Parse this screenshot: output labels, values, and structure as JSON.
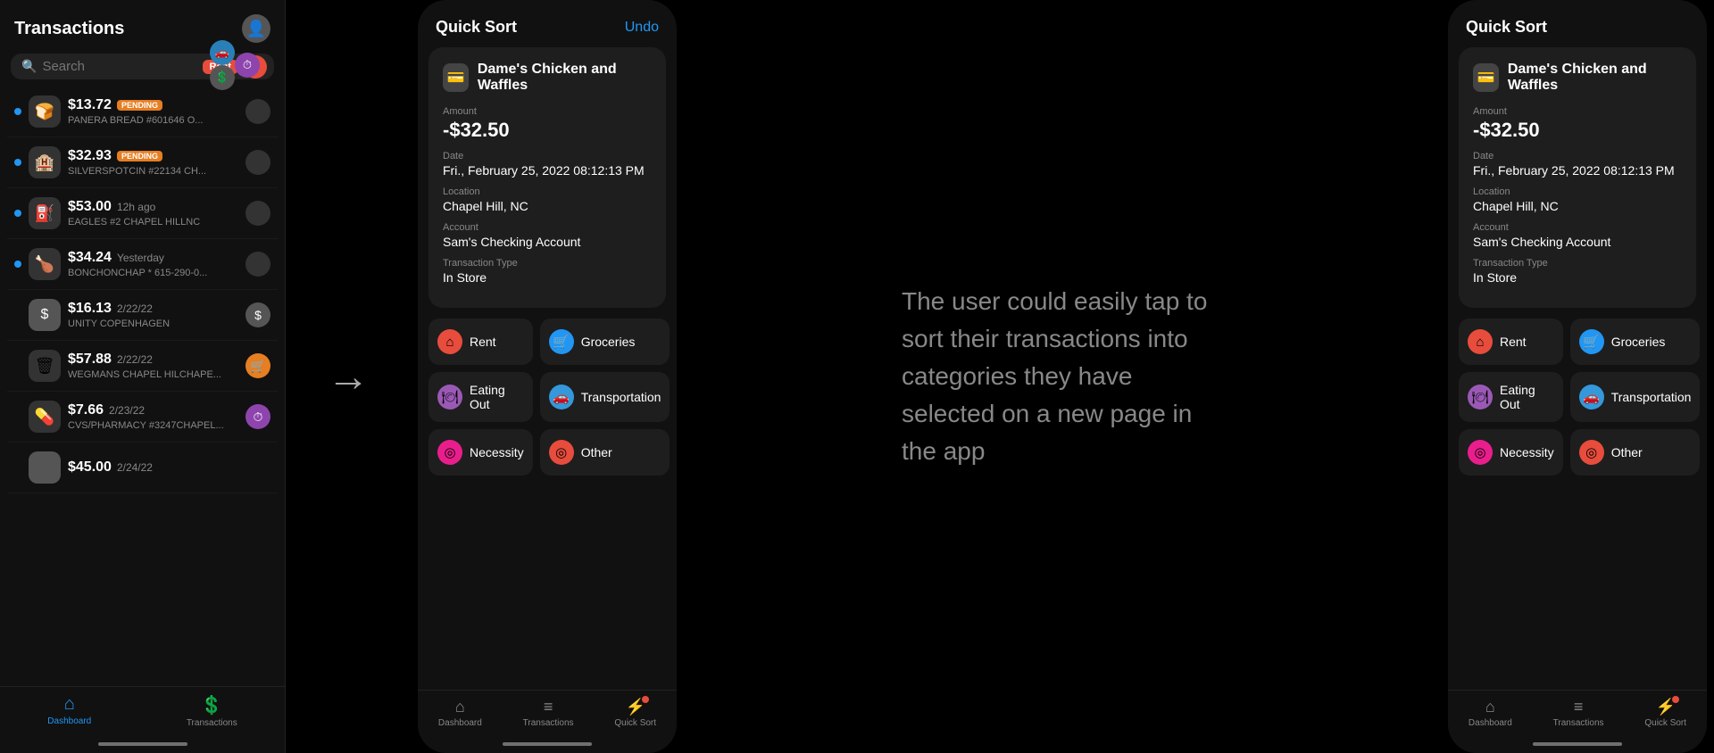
{
  "panel1": {
    "title": "Transactions",
    "search_placeholder": "Search",
    "rent_badge": "Rent",
    "transactions": [
      {
        "amount": "$13.72",
        "status": "PENDING",
        "name": "PANERA BREAD #601646 O...",
        "time": "",
        "icon": "🍞",
        "dot": true,
        "circle": "empty"
      },
      {
        "amount": "$32.93",
        "status": "PENDING",
        "name": "SILVERSPOTCIN #22134 CH...",
        "time": "",
        "icon": "🏨",
        "dot": true,
        "circle": "empty"
      },
      {
        "amount": "$53.00",
        "status": "",
        "time": "12h ago",
        "name": "EAGLES #2 CHAPEL HILLNC",
        "icon": "⛽",
        "dot": true,
        "circle": "empty"
      },
      {
        "amount": "$34.24",
        "status": "",
        "time": "Yesterday",
        "name": "BONCHONCHAP * 615-290-0...",
        "icon": "🍗",
        "dot": true,
        "circle": "empty"
      },
      {
        "amount": "$16.13",
        "status": "",
        "time": "2/22/22",
        "name": "UNITY COPENHAGEN",
        "icon": "$",
        "dot": false,
        "circle": "dollar"
      },
      {
        "amount": "$57.88",
        "status": "",
        "time": "2/22/22",
        "name": "WEGMANS CHAPEL HILCHAPE...",
        "icon": "🗑",
        "dot": false,
        "circle": "yellow"
      },
      {
        "amount": "$7.66",
        "status": "",
        "time": "2/23/22",
        "name": "CVS/PHARMACY #3247CHAPEL...",
        "icon": "💊",
        "dot": false,
        "circle": "purple"
      },
      {
        "amount": "$45.00",
        "status": "",
        "time": "2/24/22",
        "name": "",
        "icon": "",
        "dot": false,
        "circle": "empty"
      }
    ],
    "nav": [
      {
        "label": "Dashboard",
        "icon": "⌂",
        "active": true
      },
      {
        "label": "Transactions",
        "icon": "💲",
        "active": false
      }
    ]
  },
  "quicksort": {
    "title": "Quick Sort",
    "undo": "Undo",
    "card": {
      "merchant": "Dame's Chicken and Waffles",
      "amount_label": "Amount",
      "amount": "-$32.50",
      "date_label": "Date",
      "date": "Fri., February 25, 2022 08:12:13 PM",
      "location_label": "Location",
      "location": "Chapel Hill, NC",
      "account_label": "Account",
      "account": "Sam's Checking Account",
      "type_label": "Transaction Type",
      "type": "In Store"
    },
    "categories": [
      {
        "label": "Rent",
        "icon": "⌂",
        "color": "rent"
      },
      {
        "label": "Groceries",
        "icon": "🛒",
        "color": "groceries"
      },
      {
        "label": "Eating Out",
        "icon": "🍽",
        "color": "eating"
      },
      {
        "label": "Transportation",
        "icon": "🚗",
        "color": "transport"
      },
      {
        "label": "Necessity",
        "icon": "◎",
        "color": "necessity"
      },
      {
        "label": "Other",
        "icon": "◎",
        "color": "other"
      }
    ],
    "bottom_nav": [
      {
        "label": "Dashboard",
        "icon": "⌂"
      },
      {
        "label": "Transactions",
        "icon": "≡"
      },
      {
        "label": "Quick Sort",
        "icon": "⚡"
      }
    ]
  },
  "middle_text": "The user could easily tap to sort their transactions into categories they have selected on a new page in the app"
}
